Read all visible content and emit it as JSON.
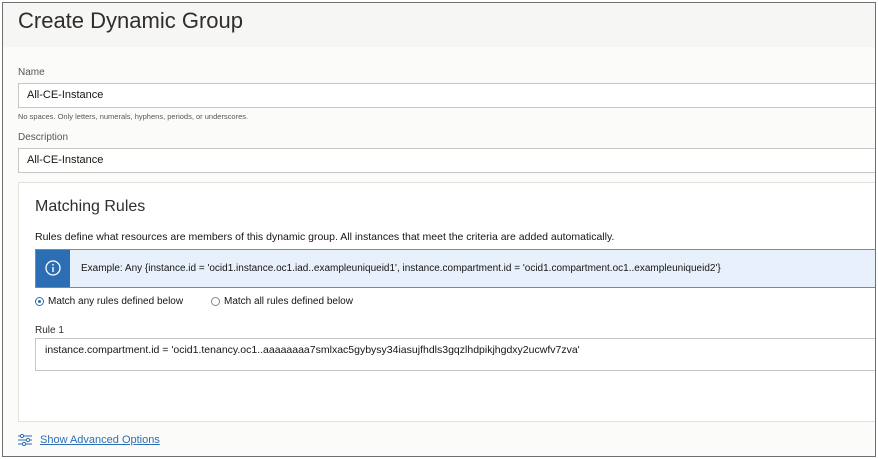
{
  "page": {
    "title": "Create Dynamic Group"
  },
  "form": {
    "name_label": "Name",
    "name_value": "All-CE-Instance",
    "name_hint": "No spaces. Only letters, numerals, hyphens, periods, or underscores.",
    "description_label": "Description",
    "description_value": "All-CE-Instance"
  },
  "matching_rules": {
    "title": "Matching Rules",
    "description": "Rules define what resources are members of this dynamic group. All instances that meet the criteria are added automatically.",
    "example_icon": "info-icon",
    "example_text": "Example: Any {instance.id = 'ocid1.instance.oc1.iad..exampleuniqueid1', instance.compartment.id = 'ocid1.compartment.oc1..exampleuniqueid2'}",
    "options": [
      {
        "label": "Match any rules defined below",
        "selected": true
      },
      {
        "label": "Match all rules defined below",
        "selected": false
      }
    ],
    "rule1_label": "Rule 1",
    "rule1_value": "instance.compartment.id = 'ocid1.tenancy.oc1..aaaaaaaa7smlxac5gybysy34iasujfhdls3gqzlhdpikjhgdxy2ucwfv7zva'"
  },
  "advanced": {
    "icon": "sliders-icon",
    "label": "Show Advanced Options"
  },
  "colors": {
    "accent": "#2c6eb4",
    "info_bg": "#e8f1fb"
  }
}
